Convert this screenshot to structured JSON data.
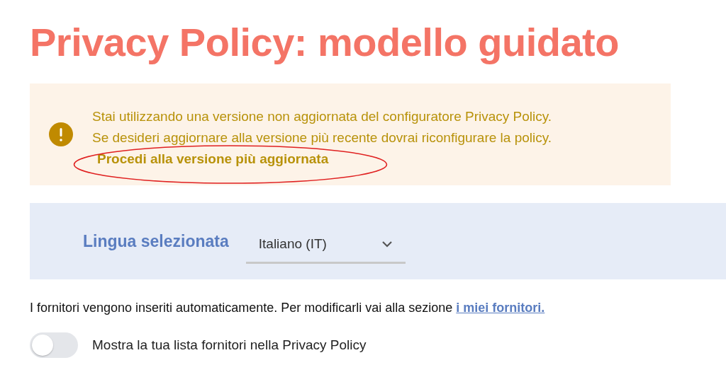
{
  "title": "Privacy Policy: modello guidato",
  "alert": {
    "lines": [
      "Stai utilizzando una versione non aggiornata del configuratore Privacy Policy.",
      "Se desideri aggiornare alla versione più recente dovrai riconfigurare la policy."
    ],
    "link": "Procedi alla versione più aggiornata",
    "annotated": true
  },
  "language": {
    "label": "Lingua selezionata",
    "value": "Italiano (IT)"
  },
  "info": {
    "text": "I fornitori vengono inseriti automaticamente. Per modificarli vai alla sezione",
    "link": "i miei fornitori."
  },
  "toggle": {
    "label": "Mostra la tua lista fornitori nella Privacy Policy",
    "on": false
  }
}
